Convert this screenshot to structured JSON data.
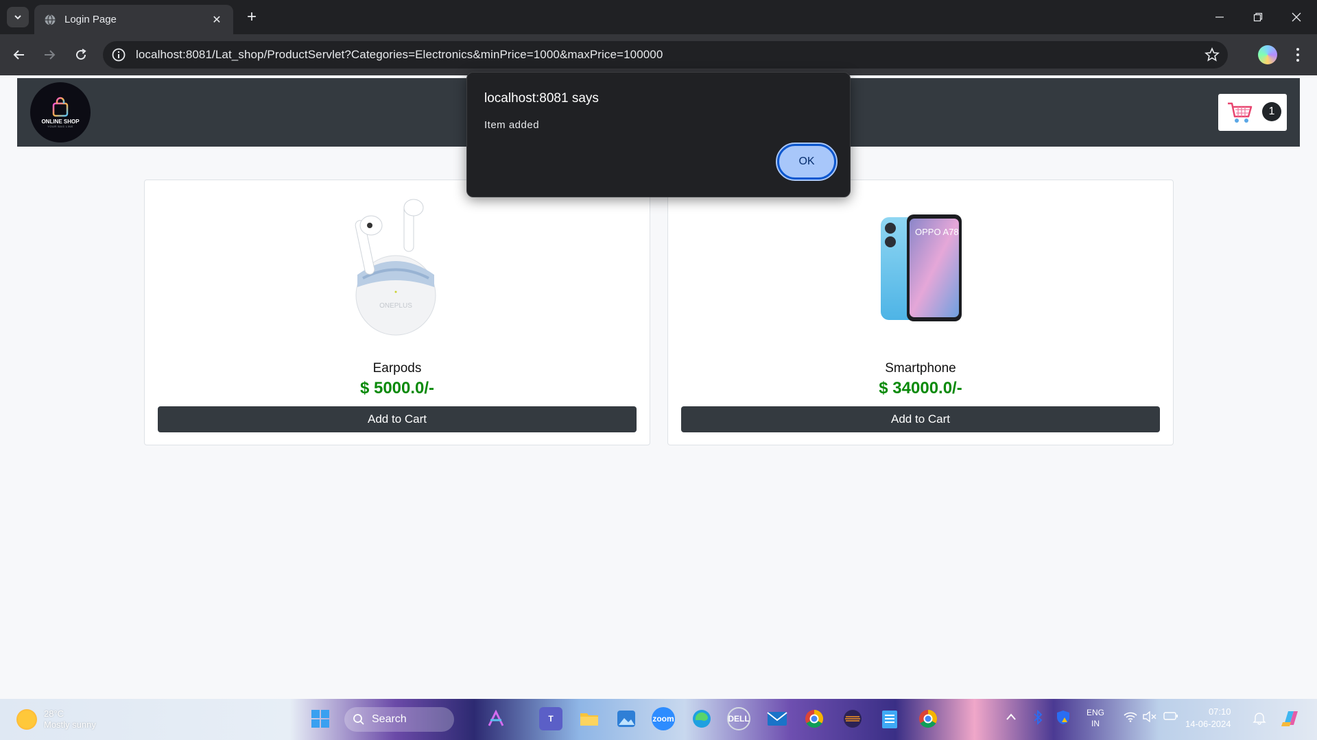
{
  "browser": {
    "tab_title": "Login Page",
    "url": "localhost:8081/Lat_shop/ProductServlet?Categories=Electronics&minPrice=1000&maxPrice=100000"
  },
  "header": {
    "logo_text": "ONLINE SHOP",
    "logo_tagline": "YOUR BAG LINE",
    "cart_count": "1"
  },
  "products": [
    {
      "name": "Earpods",
      "price": "$ 5000.0/-",
      "button": "Add to Cart",
      "image_brand": "ONEPLUS"
    },
    {
      "name": "Smartphone",
      "price": "$ 34000.0/-",
      "button": "Add to Cart",
      "image_brand": "OPPO A78"
    }
  ],
  "dialog": {
    "title": "localhost:8081 says",
    "message": "Item added",
    "ok_label": "OK"
  },
  "taskbar": {
    "temperature": "28°C",
    "weather_desc": "Mostly sunny",
    "search_label": "Search",
    "language": "ENG",
    "region": "IN",
    "time": "07:10",
    "date": "14-06-2024"
  },
  "colors": {
    "header_bg": "#343a40",
    "price_green": "#0a8a0a",
    "dialog_bg": "#202124",
    "ok_button": "#a8c7fa"
  }
}
